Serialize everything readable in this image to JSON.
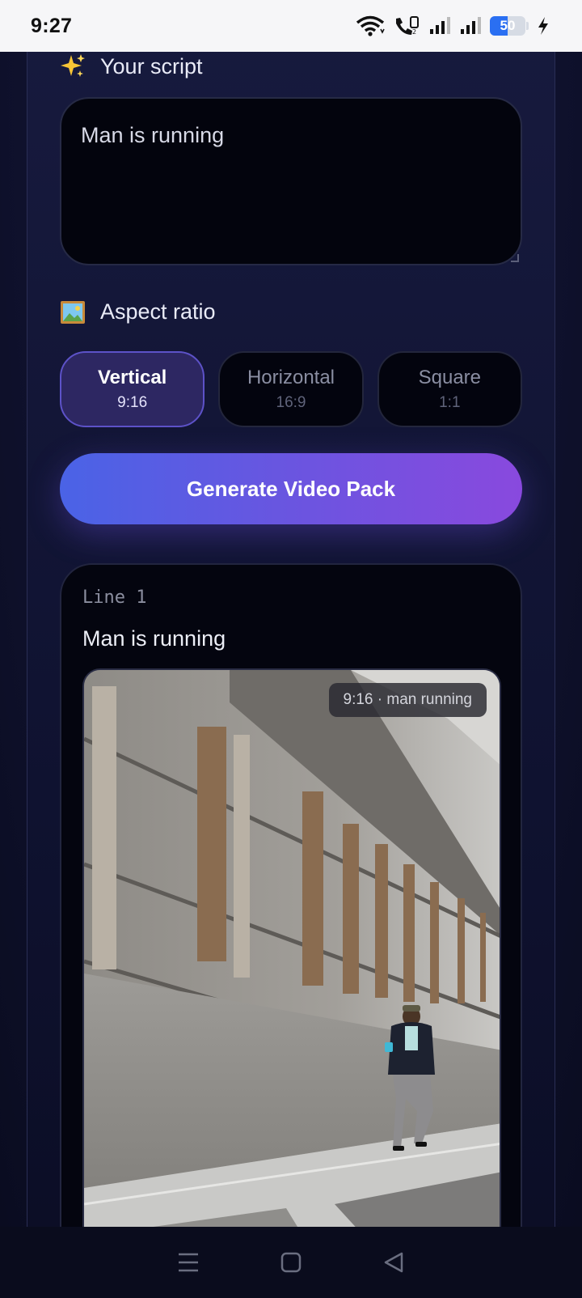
{
  "status": {
    "time": "9:27",
    "battery_level": "50"
  },
  "script_section": {
    "icon": "sparkles-icon",
    "title": "Your script",
    "value": "Man is running"
  },
  "aspect_section": {
    "icon": "framed-picture-icon",
    "title": "Aspect ratio",
    "options": [
      {
        "name": "Vertical",
        "ratio": "9:16",
        "selected": true
      },
      {
        "name": "Horizontal",
        "ratio": "16:9",
        "selected": false
      },
      {
        "name": "Square",
        "ratio": "1:1",
        "selected": false
      }
    ]
  },
  "generate_button": {
    "label": "Generate Video Pack"
  },
  "result": {
    "line_label": "Line 1",
    "line_text": "Man is running",
    "preview_tag": "9:16 · man running"
  },
  "colors": {
    "accent_start": "#4a63e6",
    "accent_end": "#8949de",
    "selected_bg": "#2d2762"
  }
}
